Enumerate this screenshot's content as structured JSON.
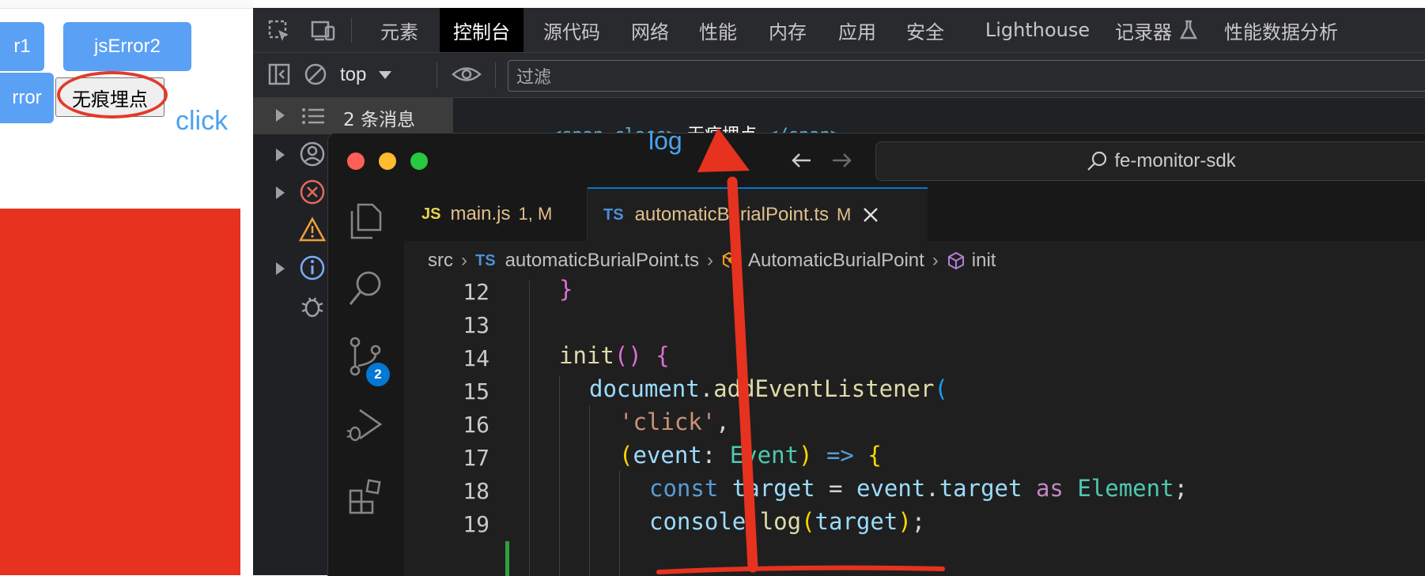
{
  "webpage": {
    "buttons": [
      {
        "label": "r1"
      },
      {
        "label": "jsError2"
      },
      {
        "label": "rror"
      }
    ],
    "plain_button": "无痕埋点",
    "click_text": "click",
    "log_text": "log"
  },
  "devtools": {
    "tabs": [
      "元素",
      "控制台",
      "源代码",
      "网络",
      "性能",
      "内存",
      "应用",
      "安全",
      "Lighthouse",
      "记录器",
      "性能数据分析"
    ],
    "active_tab": "控制台",
    "context": "top",
    "filter_placeholder": "过滤",
    "messages_label": "2 条消息",
    "console_html": {
      "open": "<span class>",
      "text": " 无痕埋点 ",
      "close": "</span>"
    }
  },
  "vscode": {
    "search": "fe-monitor-sdk",
    "tabs": [
      {
        "badge": "JS",
        "name": "main.js",
        "status": "1, M"
      },
      {
        "badge": "TS",
        "name": "automaticBurialPoint.ts",
        "status": "M"
      }
    ],
    "breadcrumb": [
      "src",
      "automaticBurialPoint.ts",
      "AutomaticBurialPoint",
      "init"
    ],
    "breadcrumb_ts_badge": "TS",
    "scm_badge": "2",
    "lines": [
      {
        "n": "12"
      },
      {
        "n": "13"
      },
      {
        "n": "14"
      },
      {
        "n": "15"
      },
      {
        "n": "16"
      },
      {
        "n": "17"
      },
      {
        "n": "18"
      },
      {
        "n": "19"
      }
    ],
    "code": {
      "l12": "}",
      "l14_fn": "init",
      "l15_obj": "document",
      "l15_fn": "addEventListener",
      "l16_str": "'click'",
      "l17_param": "event",
      "l17_type": "Event",
      "l18_kw": "const",
      "l18_var": "target",
      "l18_obj": "event",
      "l18_prop": "target",
      "l18_as": "as",
      "l18_type": "Element",
      "l19_obj": "console",
      "l19_fn": "log",
      "l19_arg": "target"
    }
  },
  "colors": {
    "annotation_red": "#e6321f",
    "button_blue": "#5aa0f5",
    "link_blue": "#4aa3f0"
  }
}
